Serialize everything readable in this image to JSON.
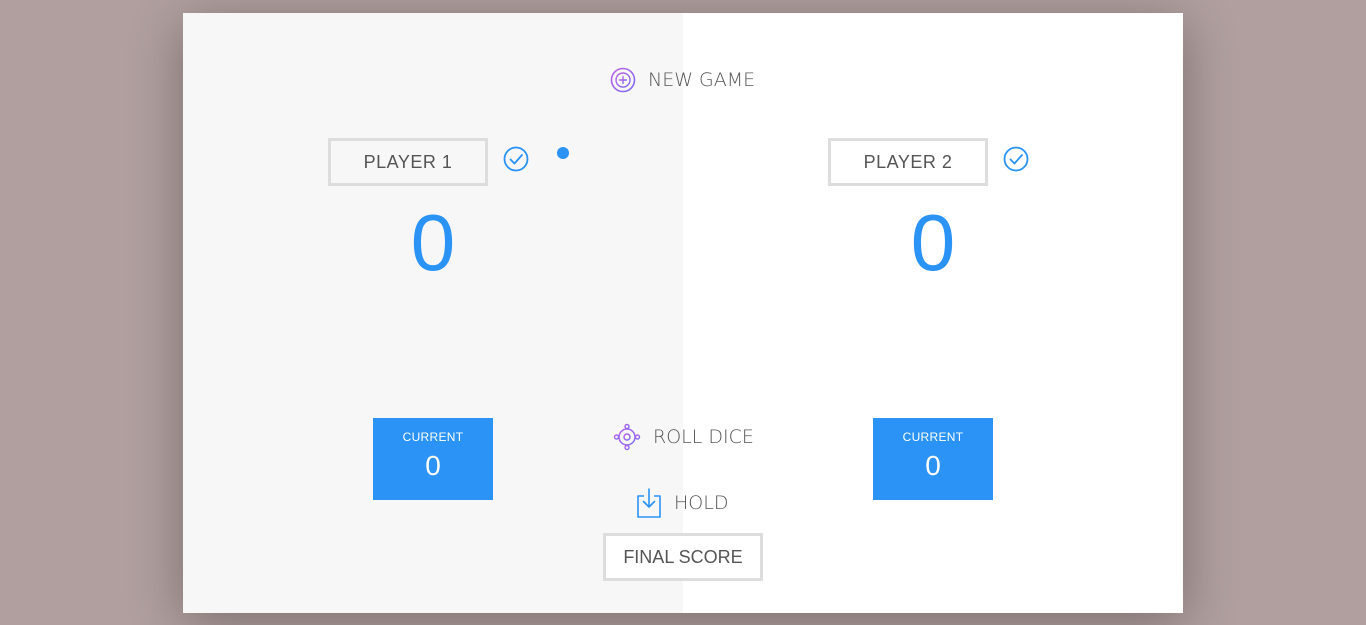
{
  "buttons": {
    "new_game": "NEW GAME",
    "roll_dice": "ROLL DICE",
    "hold": "HOLD"
  },
  "players": [
    {
      "name": "PLAYER 1",
      "score": "0",
      "current_label": "CURRENT",
      "current_score": "0",
      "active": true
    },
    {
      "name": "PLAYER 2",
      "score": "0",
      "current_label": "CURRENT",
      "current_score": "0",
      "active": false
    }
  ],
  "final_score": {
    "placeholder": "FINAL SCORE",
    "value": ""
  },
  "colors": {
    "accent": "#2a93f5",
    "page_background": "#b09f9e",
    "active_panel": "#f7f7f7",
    "icon_purple": "#a060f0"
  },
  "icons": {
    "new_game": "plus-circle-icon",
    "roll_dice": "dice-roll-icon",
    "hold": "download-icon",
    "player_check": "check-circle-icon",
    "active_indicator": "dot-icon"
  }
}
